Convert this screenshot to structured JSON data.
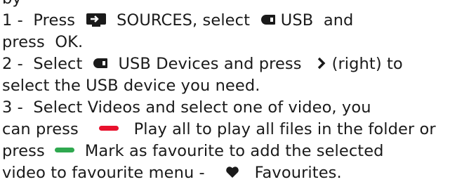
{
  "header_partial": "by",
  "steps": [
    {
      "num": "1 -",
      "press": "Press",
      "sources": "SOURCES",
      "select": ", select",
      "usb": "USB",
      "and": "and",
      "press2": "press",
      "ok": "OK",
      "end": "."
    },
    {
      "num": "2 -",
      "select": "Select",
      "usb_devices": "USB Devices",
      "and_press": "and press",
      "right": "(right) to",
      "rest": "select the USB device you need."
    },
    {
      "num": "3 -",
      "select": "Select",
      "videos": "Videos",
      "rest1": "and select one of video, you",
      "can_press": "can press",
      "play_all": "Play all",
      "to_play": "to play all files in the folder or",
      "press": "press",
      "mark_fav": "Mark as favourite",
      "to_add": "to add the selected",
      "video_to": "video to favourite menu -",
      "favourites": "Favourites",
      "end": "."
    }
  ],
  "icons": {
    "sources": "sources-icon",
    "usb": "usb-icon",
    "usb_devices": "usb-icon",
    "right": "chevron-right-icon",
    "red": "red-key-icon",
    "green": "green-key-icon",
    "heart": "heart-icon"
  },
  "colors": {
    "text": "#1a1a1a",
    "red_key": "#e8112d",
    "green_key": "#2fa84f"
  }
}
